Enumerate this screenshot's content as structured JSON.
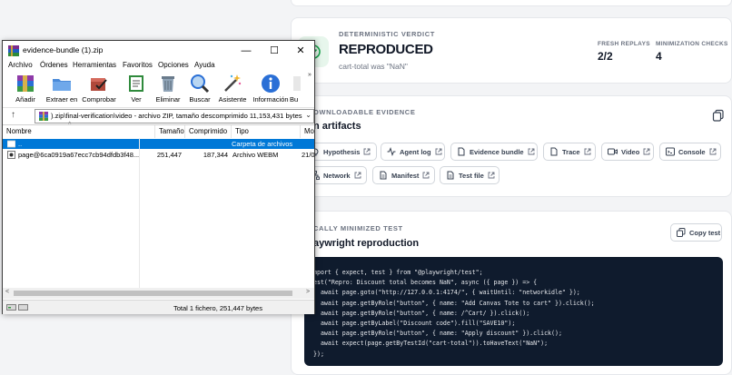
{
  "verdict": {
    "eyebrow": "DETERMINISTIC VERDICT",
    "title": "REPRODUCED",
    "subtitle": "cart-total was \"NaN\"",
    "fresh_replays_label": "FRESH REPLAYS",
    "fresh_replays_value": "2/2",
    "minimization_label": "MINIMIZATION CHECKS",
    "minimization_value": "4"
  },
  "artifacts": {
    "eyebrow": "OWNLOADABLE EVIDENCE",
    "title": "n artifacts",
    "chips": [
      {
        "label": "Hypothesis",
        "icon": "lightbulb-icon"
      },
      {
        "label": "Agent log",
        "icon": "activity-icon"
      },
      {
        "label": "Evidence bundle",
        "icon": "file-icon"
      },
      {
        "label": "Trace",
        "icon": "file-icon"
      },
      {
        "label": "Video",
        "icon": "video-icon"
      },
      {
        "label": "Console",
        "icon": "terminal-icon"
      },
      {
        "label": "Network",
        "icon": "network-icon"
      },
      {
        "label": "Manifest",
        "icon": "document-icon"
      },
      {
        "label": "Test file",
        "icon": "document-icon"
      }
    ]
  },
  "repro": {
    "eyebrow": "CALLY MINIMIZED TEST",
    "title": "aywright reproduction",
    "copy_label": "Copy test",
    "code": [
      "mport { expect, test } from \"@playwright/test\";",
      "est(\"Repro: Discount total becomes NaN\", async ({ page }) => {",
      "  await page.goto(\"http://127.0.0.1:4174/\", { waitUntil: \"networkidle\" });",
      "  await page.getByRole(\"button\", { name: \"Add Canvas Tote to cart\" }).click();",
      "  await page.getByRole(\"button\", { name: /^Cart/ }).click();",
      "  await page.getByLabel(\"Discount code\").fill(\"SAVE10\");",
      "  await page.getByRole(\"button\", { name: \"Apply discount\" }).click();",
      "  await expect(page.getByTestId(\"cart-total\")).toHaveText(\"NaN\");",
      "});"
    ]
  },
  "window": {
    "title": "evidence-bundle (1).zip",
    "minimize": "—",
    "maximize": "☐",
    "close": "✕",
    "menu": [
      "Archivo",
      "Órdenes",
      "Herramientas",
      "Favoritos",
      "Opciones",
      "Ayuda"
    ],
    "toolbar": [
      "Añadir",
      "Extraer en",
      "Comprobar",
      "Ver",
      "Eliminar",
      "Buscar",
      "Asistente",
      "Información",
      "Bu"
    ],
    "more": "»",
    "up": "↑",
    "path": ").zip\\final-verification\\video - archivo ZIP, tamaño descomprimido 11,153,431 bytes",
    "dropdown": "⌄",
    "columns": [
      "Nombre",
      "Tamaño",
      "Comprimido",
      "Tipo",
      "Mo"
    ],
    "rows": [
      {
        "name": "..",
        "size": "",
        "packed": "",
        "type": "Carpeta de archivos",
        "mod": ""
      },
      {
        "name": "page@6ca0919a67ecc7cb94dfdb3f48...",
        "size": "251,447",
        "packed": "187,344",
        "type": "Archivo WEBM",
        "mod": "21/0"
      }
    ],
    "scroll_left": "<",
    "scroll_right": ">",
    "status": "Total 1 fichero, 251,447 bytes"
  }
}
